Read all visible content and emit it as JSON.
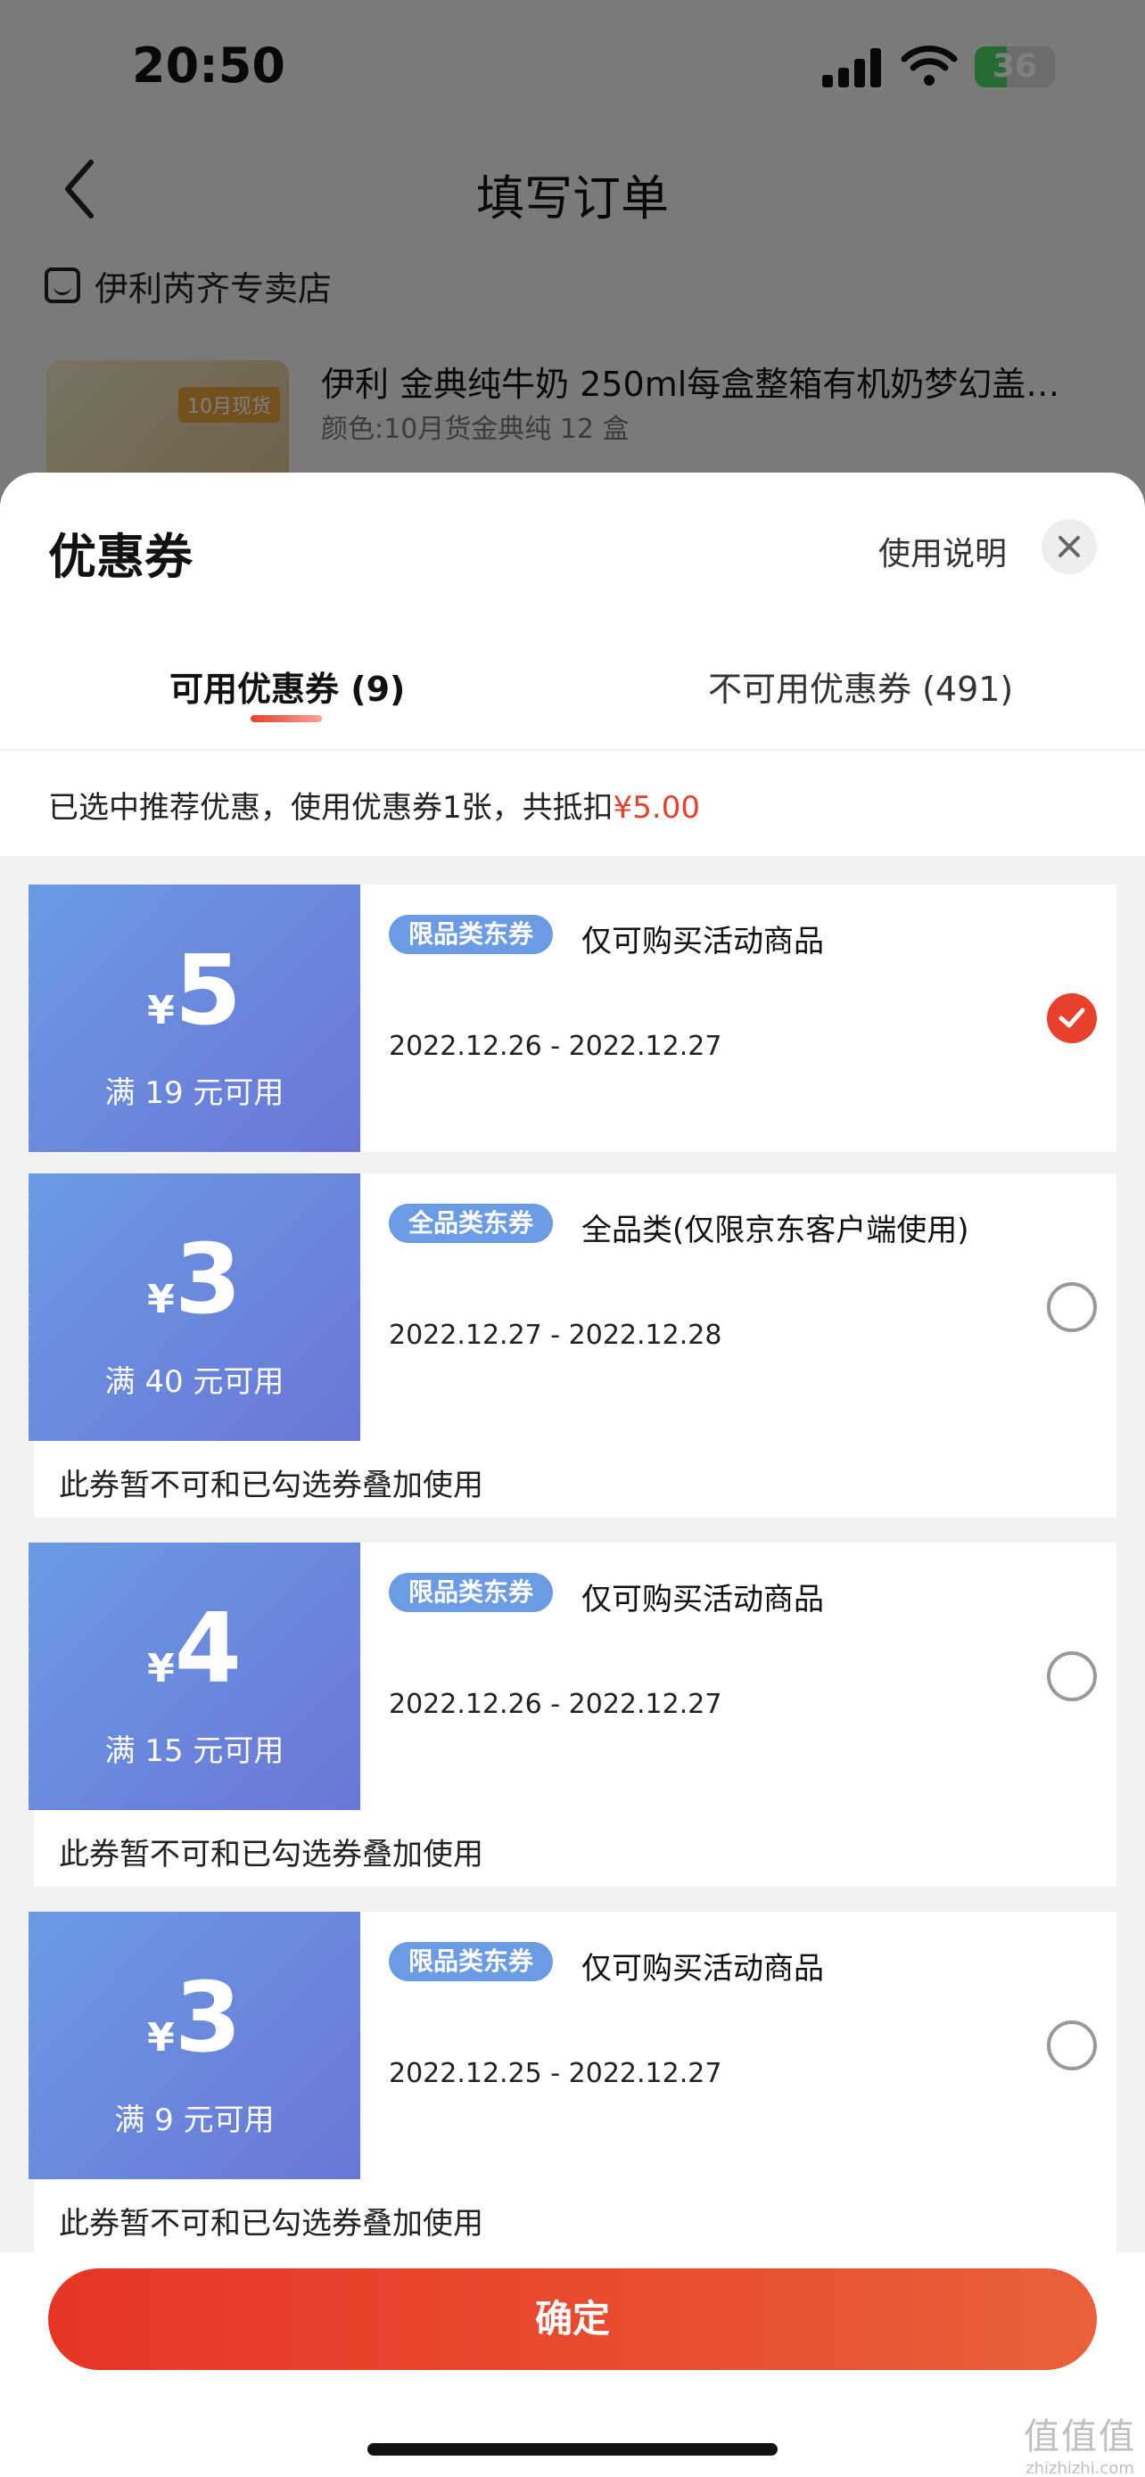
{
  "status_bar": {
    "time": "20:50",
    "battery": "36"
  },
  "nav": {
    "title": "填写订单"
  },
  "shop": {
    "name": "伊利芮齐专卖店"
  },
  "product": {
    "title": "伊利 金典纯牛奶 250ml每盒整箱有机奶梦幻盖…",
    "spec": "颜色:10月货金典纯 12 盒",
    "image_tag": "10月现货"
  },
  "sheet": {
    "title": "优惠券",
    "help": "使用说明",
    "tabs": [
      {
        "label": "可用优惠券 (9)",
        "active": true
      },
      {
        "label": "不可用优惠券 (491)",
        "active": false
      }
    ],
    "summary_prefix": "已选中推荐优惠，使用优惠券1张，共抵扣",
    "summary_amount": "¥5.00"
  },
  "coupons": [
    {
      "yen": "¥",
      "amount": "5",
      "condition": "满 19 元可用",
      "badge": "限品类东券",
      "desc": "仅可购买活动商品",
      "date": "2022.12.26 - 2022.12.27",
      "selected": true
    },
    {
      "yen": "¥",
      "amount": "3",
      "condition": "满 40 元可用",
      "badge": "全品类东券",
      "desc": "全品类(仅限京东客户端使用)",
      "date": "2022.12.27 - 2022.12.28",
      "selected": false,
      "notice": "此券暂不可和已勾选券叠加使用"
    },
    {
      "yen": "¥",
      "amount": "4",
      "condition": "满 15 元可用",
      "badge": "限品类东券",
      "desc": "仅可购买活动商品",
      "date": "2022.12.26 - 2022.12.27",
      "selected": false,
      "notice": "此券暂不可和已勾选券叠加使用"
    },
    {
      "yen": "¥",
      "amount": "3",
      "condition": "满 9 元可用",
      "badge": "限品类东券",
      "desc": "仅可购买活动商品",
      "date": "2022.12.25 - 2022.12.27",
      "selected": false,
      "notice": "此券暂不可和已勾选券叠加使用"
    }
  ],
  "footer": {
    "confirm": "确定"
  },
  "watermark": {
    "icon": "值值值",
    "text": "zhizhizhi.com"
  },
  "colors": {
    "accent": "#e8402c",
    "coupon_blue": "#6b9be3",
    "coupon_indigo": "#6a76d6"
  }
}
